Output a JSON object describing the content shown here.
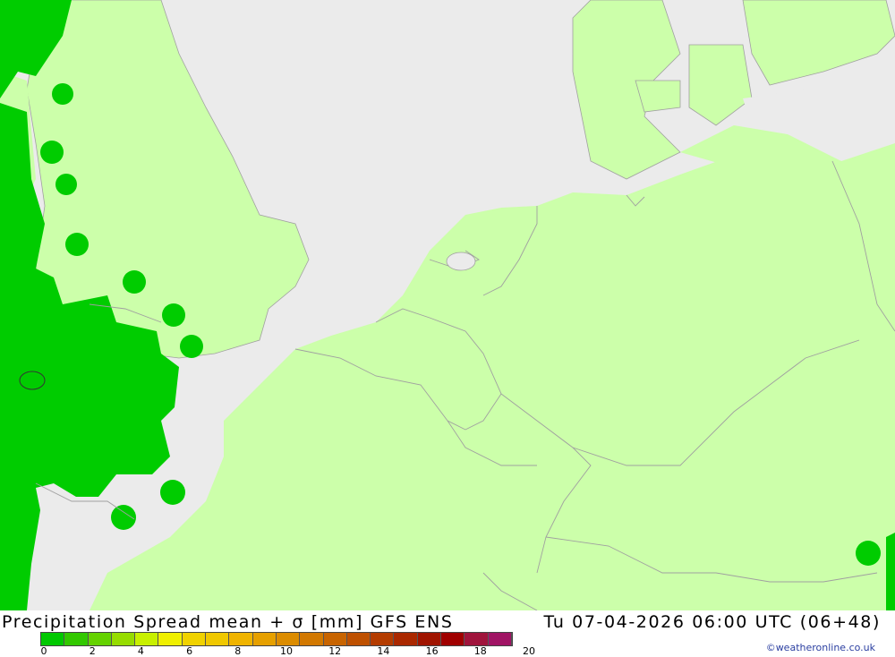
{
  "map": {
    "colors": {
      "sea": "#ebebeb",
      "land": "#ccffaa",
      "spread_0_2": "#00cc00",
      "borders": "#a0a0a0"
    }
  },
  "footer": {
    "title": "Precipitation Spread mean + σ [mm] GFS ENS",
    "datetime": "Tu 07-04-2026 06:00 UTC (06+48)",
    "credit": "©weatheronline.co.uk"
  },
  "legend": {
    "colors": [
      "#00c800",
      "#32c800",
      "#64d200",
      "#96dc00",
      "#c8f000",
      "#f0f000",
      "#f0d200",
      "#f0c800",
      "#f0b400",
      "#e6a000",
      "#dc8c00",
      "#d27800",
      "#c86400",
      "#be5000",
      "#b43c00",
      "#aa2800",
      "#a01400",
      "#a00000",
      "#a0143c",
      "#a01464"
    ],
    "ticks": [
      "0",
      "2",
      "4",
      "6",
      "8",
      "10",
      "12",
      "14",
      "16",
      "18",
      "20"
    ]
  }
}
